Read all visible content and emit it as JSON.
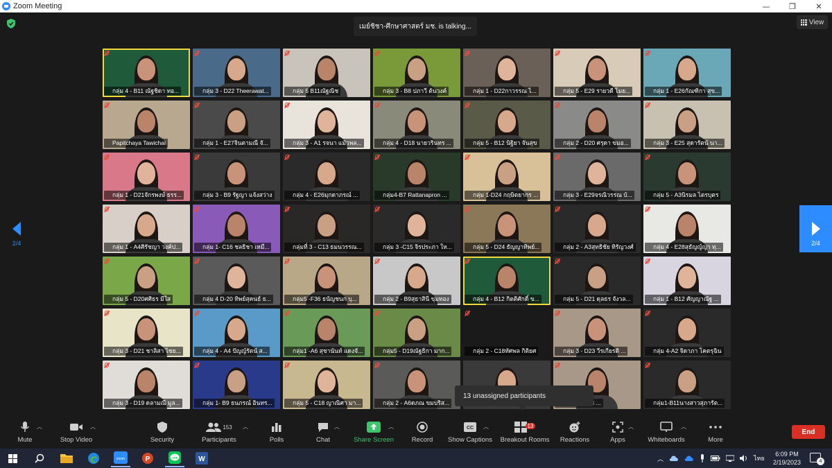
{
  "window": {
    "title": "Zoom Meeting",
    "minimize": "—",
    "maximize": "❐",
    "close": "✕"
  },
  "top": {
    "talking": "เมย์ชิชา-ศึกษาศาสตร์ มช. is talking...",
    "view_label": "View"
  },
  "colors": {
    "accent": "#2d8cff",
    "end": "#d93025",
    "mic_off": "#e74c3c",
    "highlight": "#f2d93b",
    "share": "#3ec46d"
  },
  "participants": [
    {
      "name": "กลุ่ม 4 - B11 ณัฐชิดา ทอ...",
      "bg": "#1f5a3a",
      "hl": true
    },
    {
      "name": "กลุ่ม 3 - D22 Theerawat...",
      "bg": "#4a6a8a"
    },
    {
      "name": "กลุ่ม 5 B11ณัฐณิช",
      "bg": "#c8c4bc"
    },
    {
      "name": "กลุ่ม 3 - B8 ปภาวี ต้นวงค์",
      "bg": "#7a9a3a"
    },
    {
      "name": "กลุ่ม 1 - D22กาวรรณ ไ...",
      "bg": "#6a6058"
    },
    {
      "name": "กลุ่ม 5 - E29 รายวดี โมย...",
      "bg": "#d8ccb8"
    },
    {
      "name": "กลุ่ม 1 - E26กัณฑิกา สุข...",
      "bg": "#6aa8b8"
    },
    {
      "name": "Papitchaya Tawichai",
      "bg": "#b8a890"
    },
    {
      "name": "กลุ่ม 1 - E27จินตามณี จั...",
      "bg": "#4a4a4a"
    },
    {
      "name": "กลุ่ม 3 - A1 รจนา แม้วพล...",
      "bg": "#e8e4dc"
    },
    {
      "name": "กลุ่ม 4 - D18 นายวรินทร ...",
      "bg": "#8a8a7a"
    },
    {
      "name": "กลุ่ม 5 - B12 นิฐิยา จันสุข",
      "bg": "#5a5a48"
    },
    {
      "name": "กลุ่ม 2 - D20 ศรุดา ขมอ...",
      "bg": "#8a8a88"
    },
    {
      "name": "กลุ่ม 3 - E25 สุดารัตน์ นา...",
      "bg": "#c8c0b0"
    },
    {
      "name": "กลุ่ม 1 - D21จักรพงษ์ ธรร...",
      "bg": "#d87888"
    },
    {
      "name": "กลุ่ม 3 - B9 รัฐญา แจ้งสว่าง",
      "bg": "#3a3a3a"
    },
    {
      "name": "กลุ่ม 4 - E26มุกดาภรณ์ ...",
      "bg": "#2a2a2a"
    },
    {
      "name": "กลุ่ม4-B7 Rattanapron ...",
      "bg": "#2a3a2a"
    },
    {
      "name": "กลุ่ม 1-D24 กฤษิตยากร ...",
      "bg": "#d8c098"
    },
    {
      "name": "กลุ่ม 3 - E29จรณิวรรณ บ้...",
      "bg": "#6a6a6a"
    },
    {
      "name": "กลุ่ม 5 - A3นิรมล ไตรบุตร",
      "bg": "#2a3a30"
    },
    {
      "name": "กลุ่ม 1 - A4ศิรัชญา วงค์ป...",
      "bg": "#d8d0c8"
    },
    {
      "name": "กลุ่ม 1- C16 ชลธิชา เหมื...",
      "bg": "#8a5ab8"
    },
    {
      "name": "กลุ่มที่ 3 - C13 ธมนวรรณ...",
      "bg": "#2a2826"
    },
    {
      "name": "กลุ่ม 3 -C15 จิรประภา ให...",
      "bg": "#2a2a2a"
    },
    {
      "name": "กลุ่ม 5 - D24 ธัญญาทิพย์...",
      "bg": "#8a7858"
    },
    {
      "name": "กลุ่ม 2 - A3สุทธิชัย ทิรัญวงศ์",
      "bg": "#2a2a2a"
    },
    {
      "name": "กลุ่ม 4 - E28สุธัญญ์ญา ทุ...",
      "bg": "#e8e8e4"
    },
    {
      "name": "กลุ่ม 5 - D20ศศิธร มีใส",
      "bg": "#7aa848"
    },
    {
      "name": "กลุ่ม 4 D-20 ทิพย์สุคนธ์ ธ...",
      "bg": "#5a5a5a"
    },
    {
      "name": "กลุ่ม5 -F36 ธนัญชนก บุ...",
      "bg": "#b8a888"
    },
    {
      "name": "กลุ่ม 2 - B9สุธาสินี ขุมทอง",
      "bg": "#c8c8c8"
    },
    {
      "name": "กลุ่ม 4 - B12 กิตติศักดิ์ ข...",
      "bg": "#1f5a3a",
      "hl": true
    },
    {
      "name": "กลุ่ม 5 - D21 ดุลธร จังวล...",
      "bg": "#2a2a2a"
    },
    {
      "name": "กลุ่ม 1 - B12 ศัญญาณัฐ ...",
      "bg": "#d8d4e0"
    },
    {
      "name": "กลุ่ม 3 - D21 ชาลิสา ไชย...",
      "bg": "#e8e4c8"
    },
    {
      "name": "กลุ่ม 4 - A4 ปัญญ์รัตน์ ส...",
      "bg": "#5a9ac8"
    },
    {
      "name": "กลุ่ม1 -A6 สุชานันท์ แดงจั...",
      "bg": "#6a9a58"
    },
    {
      "name": "กลุ่ม5 - D19ณัฐธิกา มาก...",
      "bg": "#6a8a48"
    },
    {
      "name": "กลุ่ม 2 - C18ทัศพล กิติยศ",
      "bg": "#1a1a1a",
      "empty": true
    },
    {
      "name": "กลุ่ม 3 - D23 วีรเกียรติ ...",
      "bg": "#a89888"
    },
    {
      "name": "กลุ่ม 4-A2 จิดาภา โคตรุฉิน",
      "bg": "#2a2a2a"
    },
    {
      "name": "กลุ่ม 3 - D19 ดลามณี มูล...",
      "bg": "#e0dcd8"
    },
    {
      "name": "กลุ่ม 1- B9 ธนภรณ์ อินทร...",
      "bg": "#2a3a8a"
    },
    {
      "name": "กลุ่ม 5 - C18 ญาณิศา มา...",
      "bg": "#c8b890"
    },
    {
      "name": "กลุ่ม 2 - A6ดภณ ขมบริส...",
      "bg": "#5a5a58"
    },
    {
      "name": "",
      "bg": "#3a3a3a"
    },
    {
      "name": "17 วรรณนิช ...",
      "bg": "#a89888"
    },
    {
      "name": "กลุ่ม1-B11นางสาวสุภารัต...",
      "bg": "#2a2a2a"
    }
  ],
  "nav": {
    "page": "2/4"
  },
  "popup": {
    "text": "13 unassigned participants"
  },
  "toolbar": {
    "mute": "Mute",
    "stop_video": "Stop Video",
    "security": "Security",
    "participants": "Participants",
    "participants_count": "153",
    "polls": "Polls",
    "chat": "Chat",
    "share_screen": "Share Screen",
    "record": "Record",
    "show_captions": "Show Captions",
    "breakout_rooms": "Breakout Rooms",
    "breakout_badge": "13",
    "reactions": "Reactions",
    "apps": "Apps",
    "whiteboards": "Whiteboards",
    "more": "More",
    "end": "End"
  },
  "taskbar": {
    "apps": [
      "windows-start",
      "search",
      "file-explorer",
      "edge",
      "zoom",
      "powerpoint",
      "line",
      "word"
    ],
    "lang": "ไทย",
    "time": "6:09 PM",
    "date": "2/19/2023",
    "notif_count": "4"
  }
}
